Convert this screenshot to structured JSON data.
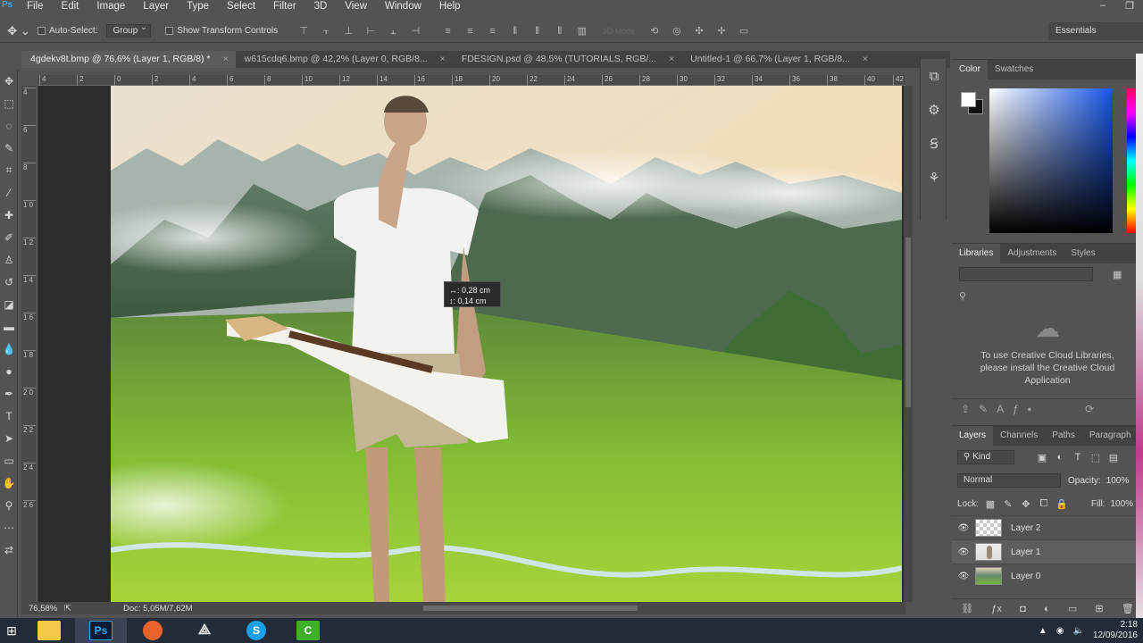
{
  "menu": {
    "logo": "Ps",
    "items": [
      "File",
      "Edit",
      "Image",
      "Layer",
      "Type",
      "Select",
      "Filter",
      "3D",
      "View",
      "Window",
      "Help"
    ],
    "window_controls": [
      "–",
      "❐"
    ]
  },
  "options_bar": {
    "auto_select_label": "Auto-Select:",
    "auto_select_value": "Group",
    "show_transform_label": "Show Transform Controls",
    "mode_3d_label": "3D Mode:",
    "workspace": "Essentials"
  },
  "tabs": [
    {
      "label": "4gdekv8t.bmp @ 76,6% (Layer 1, RGB/8) *"
    },
    {
      "label": "w615cdq6.bmp @ 42,2% (Layer 0, RGB/8..."
    },
    {
      "label": "FDESIGN.psd @ 48,5% (TUTORIALS, RGB/..."
    },
    {
      "label": "Untitled-1 @ 66,7% (Layer 1, RGB/8..."
    }
  ],
  "tab_close": "×",
  "ruler_h": [
    "4",
    "2",
    "0",
    "2",
    "4",
    "6",
    "8",
    "10",
    "12",
    "14",
    "16",
    "18",
    "20",
    "22",
    "24",
    "26",
    "28",
    "30",
    "32",
    "34",
    "36",
    "38",
    "40",
    "42"
  ],
  "ruler_v": [
    "4",
    "6",
    "8",
    "1 0",
    "1 2",
    "1 4",
    "1 6",
    "1 8",
    "2 0",
    "2 2",
    "2 4",
    "2 6"
  ],
  "measure_tooltip": {
    "width_label": "↔:",
    "width_value": "0,28 cm",
    "height_label": "↕:",
    "height_value": "0,14 cm"
  },
  "status": {
    "zoom": "76,58%",
    "doc": "Doc: 5,05M/7,62M"
  },
  "color_panel": {
    "tabs": [
      "Color",
      "Swatches"
    ],
    "foreground": "#ffffff",
    "background": "#111111",
    "hue_color": "#1655e8"
  },
  "libraries_panel": {
    "tabs": [
      "Libraries",
      "Adjustments",
      "Styles"
    ],
    "message": "To use Creative Cloud Libraries, please install the Creative Cloud Application"
  },
  "layers_panel": {
    "tabs": [
      "Layers",
      "Channels",
      "Paths",
      "Paragraph"
    ],
    "filter_kind": "Kind",
    "blend_mode": "Normal",
    "opacity_label": "Opacity:",
    "opacity_value": "100%",
    "lock_label": "Lock:",
    "fill_label": "Fill:",
    "fill_value": "100%",
    "layers": [
      {
        "name": "Layer 2",
        "visible": true,
        "selected": false,
        "thumb": "transparent"
      },
      {
        "name": "Layer 1",
        "visible": true,
        "selected": true,
        "thumb": "person"
      },
      {
        "name": "Layer 0",
        "visible": true,
        "selected": false,
        "thumb": "landscape"
      }
    ]
  },
  "taskbar": {
    "apps": [
      {
        "name": "file-explorer",
        "label": "",
        "color": "#f3c84a"
      },
      {
        "name": "photoshop",
        "label": "Ps",
        "color": "#0b1b33"
      },
      {
        "name": "firefox",
        "label": "",
        "color": "#e8632b"
      },
      {
        "name": "unity",
        "label": "",
        "color": "#e9e9e9"
      },
      {
        "name": "skype",
        "label": "S",
        "color": "#1aa0e6"
      },
      {
        "name": "camtasia",
        "label": "C",
        "color": "#3fae2a"
      }
    ],
    "time": "2:18",
    "date": "12/09/2016"
  }
}
